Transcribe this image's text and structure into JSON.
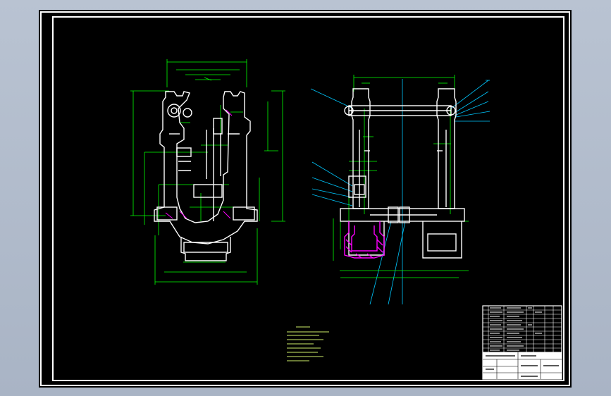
{
  "colors": {
    "background": "#000000",
    "border": "#ffffff",
    "body_outline": "#ffffff",
    "dimension": "#00ff00",
    "hatch": "#ff00ff",
    "leader": "#00c8ff",
    "notes_text": "#d0f06a",
    "table_fill": "#ffffff"
  },
  "drawing": {
    "left_view": "left-section-view",
    "right_view": "right-assembly-view",
    "notes_lines": 7
  }
}
